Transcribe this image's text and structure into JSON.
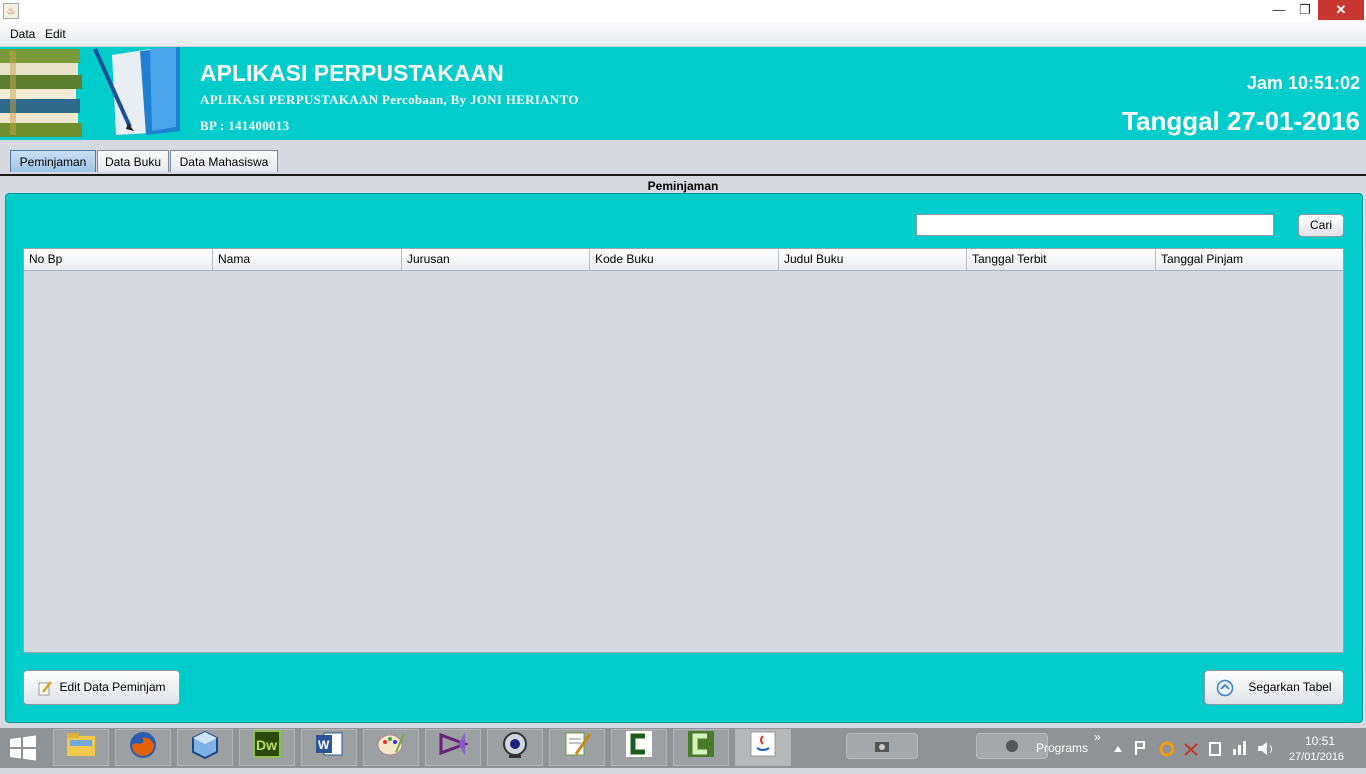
{
  "window": {
    "minimize_glyph": "—",
    "maximize_glyph": "❐",
    "close_glyph": "✕",
    "app_icon": "java-icon"
  },
  "menu": [
    "Data",
    "Edit"
  ],
  "header": {
    "title": "APLIKASI PERPUSTAKAAN",
    "subtitle": "APLIKASI PERPUSTAKAAN Percobaan, By JONI HERIANTO",
    "bp": "BP : 141400013",
    "clock": "Jam 10:51:02",
    "date": "Tanggal 27-01-2016"
  },
  "tabs": [
    "Peminjaman",
    "Data Buku",
    "Data Mahasiswa"
  ],
  "panel": {
    "title": "Peminjaman",
    "search_value": "",
    "search_button": "Cari",
    "columns": [
      "No Bp",
      "Nama",
      "Jurusan",
      "Kode Buku",
      "Judul Buku",
      "Tanggal Terbit",
      "Tanggal Pinjam"
    ],
    "rows": [],
    "edit_button": "Edit Data Peminjam",
    "refresh_button": "Segarkan Tabel"
  },
  "taskbar": {
    "apps": [
      "file-explorer-icon",
      "firefox-icon",
      "virtualbox-icon",
      "dreamweaver-icon",
      "word-icon",
      "paint-icon",
      "visual-studio-icon",
      "webcam-icon",
      "notepadpp-icon",
      "camtasia-icon",
      "camtasia-recorder-icon",
      "java-icon"
    ],
    "programs_label": "Programs",
    "programs_chevron": "»",
    "time": "10:51",
    "date": "27/01/2016"
  },
  "colors": {
    "header_bg": "#00cccc",
    "panel_bg": "#00cccc",
    "table_bg": "#d6d9e0",
    "close_btn": "#c7372f"
  }
}
